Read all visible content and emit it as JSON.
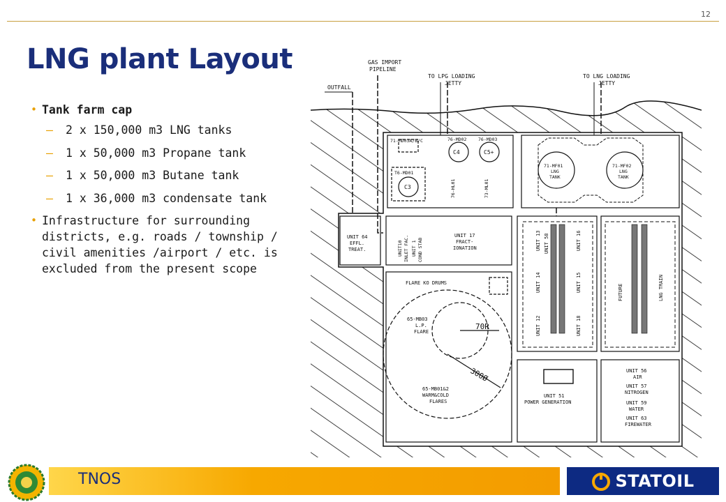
{
  "slide": {
    "number": "12",
    "title": "LNG plant Layout"
  },
  "bullets": [
    {
      "text": "Tank farm cap",
      "bold": true,
      "subs": [
        "2 x 150,000 m3 LNG tanks",
        "1 x 50,000 m3 Propane tank",
        "1 x 50,000 m3 Butane tank",
        "1 x 36,000 m3 condensate tank"
      ]
    },
    {
      "text": "Infrastructure for surrounding districts, e.g. roads / township / civil amenities /airport / etc. is excluded from the present scope",
      "bold": false,
      "subs": []
    }
  ],
  "layout": {
    "gas_import": "GAS IMPORT",
    "pipeline": "PIPELINE",
    "outfall": "OUTFALL",
    "lpg_jetty_1": "TO LPG LOADING",
    "lpg_jetty_2": "JETTY",
    "lng_jetty_1": "TO LNG LOADING",
    "lng_jetty_2": "JETTY",
    "tank_a": "71-MD03A/B/C",
    "tank_b": "76-MD02",
    "tank_c": "76-MD03",
    "c4": "C4",
    "c5": "C5+",
    "c3": "C3",
    "t6md01": "T6-MD01",
    "t6hl01": "76-HL01",
    "t3ml01": "73-ML01",
    "lng_tank_1a": "71-MF01",
    "lng_tank_1b": "LNG",
    "lng_tank_1c": "TANK",
    "lng_tank_2a": "71-MF02",
    "lng_tank_2b": "LNG",
    "lng_tank_2c": "TANK",
    "unit64a": "UNIT 64",
    "unit64b": "EFFL.",
    "unit64c": "TREAT.",
    "unit10a": "UNIT10",
    "unit10b": "INLET FAC.",
    "unit1a": "UNIT 1",
    "unit1b": "COND STAB",
    "unit17a": "UNIT 17",
    "unit17b": "FRACT-",
    "unit17c": "IONATION",
    "flare_ko": "FLARE KO DRUMS",
    "lp_flare_a": "65-MB03",
    "lp_flare_b": "L.P.",
    "lp_flare_c": "FLARE",
    "r70": "70R",
    "d300": "300Ø",
    "warm_a": "65-MB01&2",
    "warm_b": "WARM&COLD",
    "warm_c": "FLARES",
    "unit13": "UNIT 13",
    "unit58": "UNIT 58",
    "unit16": "UNIT 16",
    "unit14": "UNIT 14",
    "unit15": "UNIT 15",
    "unit12": "UNIT 12",
    "unit18": "UNIT 18",
    "future": "FUTURE",
    "lng_train": "LNG TRAIN",
    "unit51a": "UNIT 51",
    "unit51b": "POWER GENERATION",
    "unit56a": "UNIT 56",
    "unit56b": "AIR",
    "unit57a": "UNIT 57",
    "unit57b": "NITROGEN",
    "unit59a": "UNIT 59",
    "unit59b": "WATER",
    "unit63a": "UNIT 63",
    "unit63b": "FIREWATER"
  },
  "footer": {
    "label": "TNOS",
    "brand": "STATOIL",
    "colors": {
      "bar": "#f7a800",
      "brand_bg": "#0d2a82",
      "title": "#1a2e7a"
    }
  }
}
